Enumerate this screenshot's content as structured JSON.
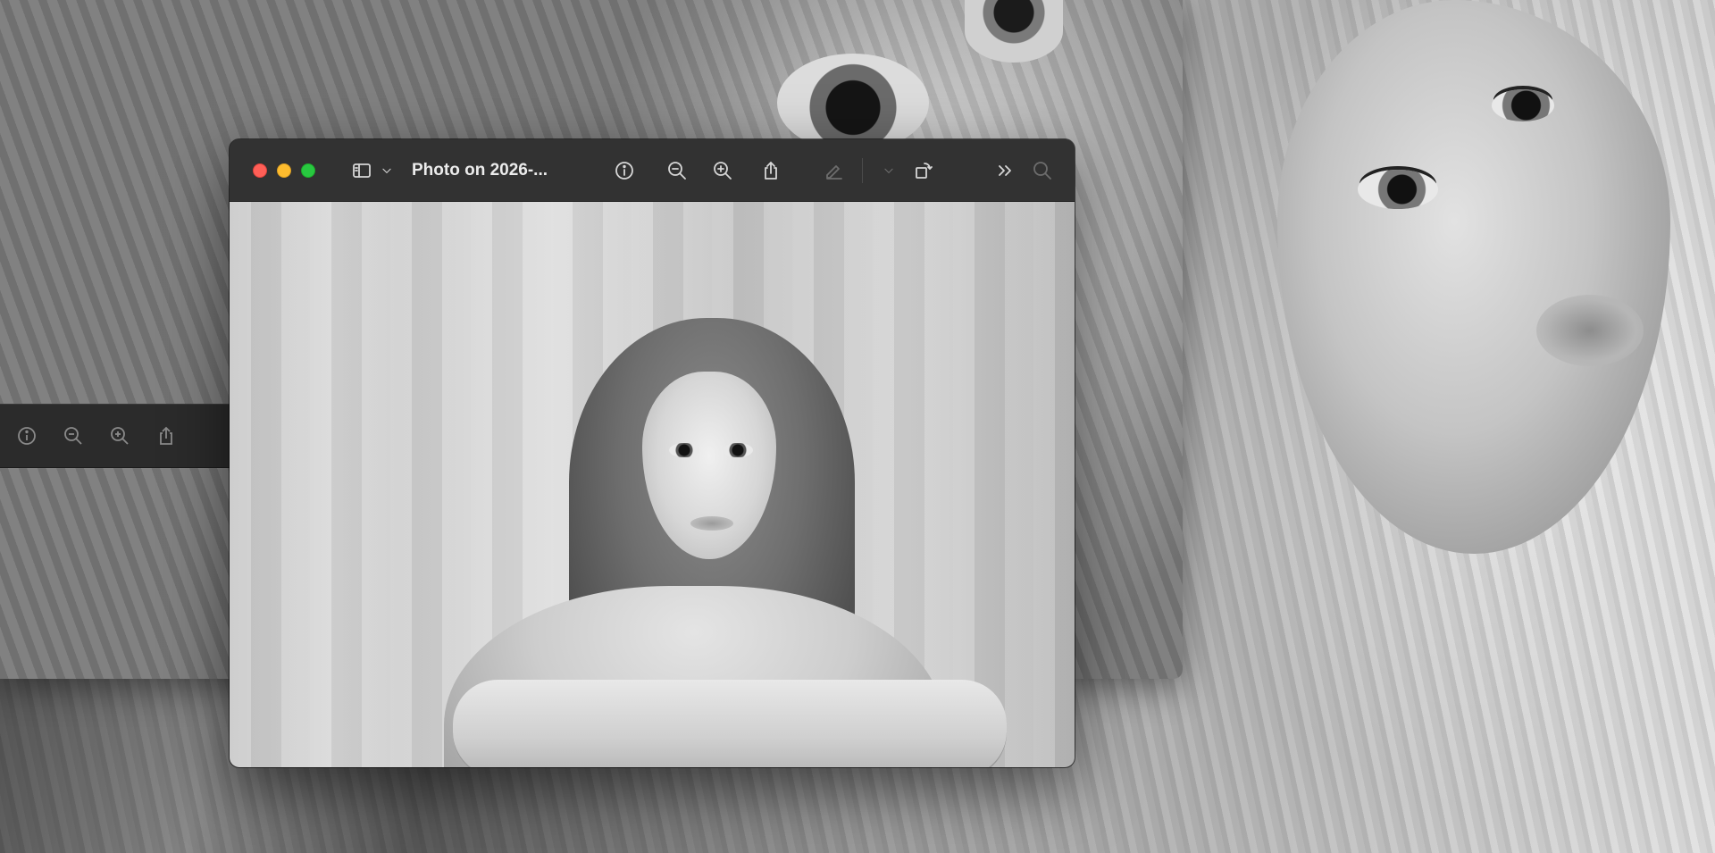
{
  "desktop": {
    "background_description": "full-screen grayscale portrait"
  },
  "back_window": {
    "toolbar_icons": [
      "info-icon",
      "zoom-out-icon",
      "zoom-in-icon",
      "share-icon"
    ]
  },
  "front_window": {
    "title": "Photo on 2026-...",
    "traffic_lights": {
      "close_color": "#ff5f57",
      "minimize_color": "#febc2e",
      "maximize_color": "#28c840"
    },
    "toolbar_icons": [
      "sidebar-icon",
      "chevron-down-icon",
      "info-icon",
      "zoom-out-icon",
      "zoom-in-icon",
      "share-icon",
      "markup-pencil-icon",
      "chevron-down-icon",
      "rotate-icon",
      "more-chevrons-icon",
      "search-icon"
    ],
    "toolbar_icon_color": "#d7d7d7",
    "disabled_icon_color": "#6d6d6d",
    "titlebar_color": "#323232"
  }
}
